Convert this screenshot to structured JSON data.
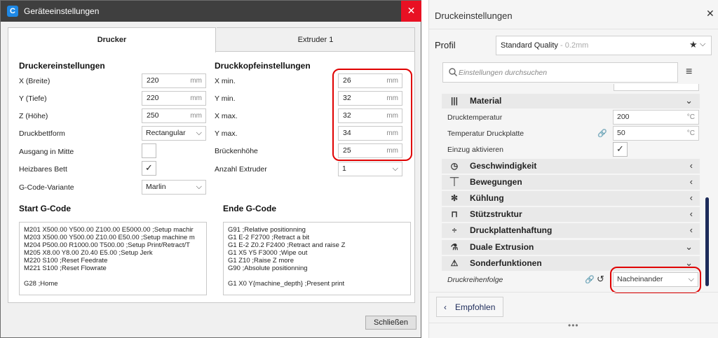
{
  "dialog": {
    "title": "Geräteeinstellungen",
    "close_symbol": "✕",
    "tabs": [
      "Drucker",
      "Extruder 1"
    ],
    "printer_settings": {
      "heading": "Druckereinstellungen",
      "x_label": "X (Breite)",
      "x_value": "220",
      "x_unit": "mm",
      "y_label": "Y (Tiefe)",
      "y_value": "220",
      "y_unit": "mm",
      "z_label": "Z (Höhe)",
      "z_value": "250",
      "z_unit": "mm",
      "bed_shape_label": "Druckbettform",
      "bed_shape_value": "Rectangular",
      "origin_center_label": "Ausgang in Mitte",
      "heated_bed_label": "Heizbares Bett",
      "gcode_flavor_label": "G-Code-Variante",
      "gcode_flavor_value": "Marlin"
    },
    "printhead_settings": {
      "heading": "Druckkopfeinstellungen",
      "xmin_label": "X min.",
      "xmin_value": "26",
      "xmin_unit": "mm",
      "ymin_label": "Y min.",
      "ymin_value": "32",
      "ymin_unit": "mm",
      "xmax_label": "X max.",
      "xmax_value": "32",
      "xmax_unit": "mm",
      "ymax_label": "Y max.",
      "ymax_value": "34",
      "ymax_unit": "mm",
      "gantry_label": "Brückenhöhe",
      "gantry_value": "25",
      "gantry_unit": "mm",
      "extruder_count_label": "Anzahl Extruder",
      "extruder_count_value": "1"
    },
    "start_gcode": {
      "heading": "Start G-Code",
      "text": "M201 X500.00 Y500.00 Z100.00 E5000.00 ;Setup machir\nM203 X500.00 Y500.00 Z10.00 E50.00 ;Setup machine m\nM204 P500.00 R1000.00 T500.00 ;Setup Print/Retract/T\nM205 X8.00 Y8.00 Z0.40 E5.00 ;Setup Jerk\nM220 S100 ;Reset Feedrate\nM221 S100 ;Reset Flowrate\n\nG28 ;Home"
    },
    "end_gcode": {
      "heading": "Ende G-Code",
      "text": "G91 ;Relative positionning\nG1 E-2 F2700 ;Retract a bit\nG1 E-2 Z0.2 F2400 ;Retract and raise Z\nG1 X5 Y5 F3000 ;Wipe out\nG1 Z10 ;Raise Z more\nG90 ;Absolute positionning\n\nG1 X0 Y{machine_depth} ;Present print"
    },
    "close_button": "Schließen",
    "accent_color": "#e00000"
  },
  "panel": {
    "title": "Druckeinstellungen",
    "close_symbol": "✕",
    "profile_label": "Profil",
    "profile_value": "Standard Quality",
    "profile_sub": " - 0.2mm",
    "search_placeholder": "Einstellungen durchsuchen",
    "categories": [
      {
        "label": "Material",
        "icon": "material-icon",
        "expanded": true
      },
      {
        "label": "Geschwindigkeit",
        "icon": "speed-icon"
      },
      {
        "label": "Bewegungen",
        "icon": "travel-icon"
      },
      {
        "label": "Kühlung",
        "icon": "fan-icon"
      },
      {
        "label": "Stützstruktur",
        "icon": "support-icon"
      },
      {
        "label": "Druckplattenhaftung",
        "icon": "adhesion-icon"
      },
      {
        "label": "Duale Extrusion",
        "icon": "dual-extrusion-icon",
        "expanded": true
      },
      {
        "label": "Sonderfunktionen",
        "icon": "special-modes-icon",
        "expanded": true
      }
    ],
    "material_settings": {
      "print_temp_label": "Drucktemperatur",
      "print_temp_value": "200",
      "print_temp_unit": "°C",
      "bed_temp_label": "Temperatur Druckplatte",
      "bed_temp_value": "50",
      "bed_temp_unit": "°C",
      "retraction_label": "Einzug aktivieren"
    },
    "print_sequence_label": "Druckreihenfolge",
    "print_sequence_value": "Nacheinander",
    "recommended_button": "Empfohlen",
    "brand_color": "#1d2b5a"
  }
}
